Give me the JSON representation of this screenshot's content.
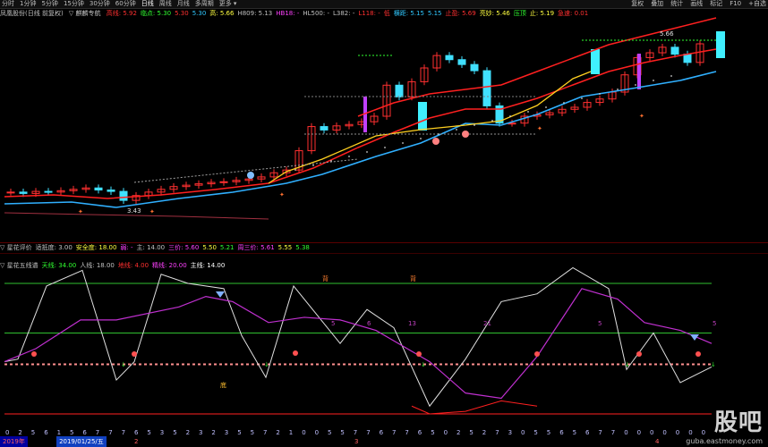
{
  "topbar": {
    "tabs": [
      "分时",
      "1分钟",
      "5分钟",
      "15分钟",
      "30分钟",
      "60分钟",
      "日线",
      "周线",
      "月线",
      "多周期",
      "更多 ▾"
    ],
    "active_tab": "日线",
    "right": [
      "复权",
      "叠加",
      "统计",
      "画线",
      "标记",
      "F10",
      "+自选"
    ]
  },
  "info": {
    "stock": "凤凰股份(日线 前复权)",
    "indicator": "▽ 麒麟专航",
    "items": [
      {
        "t": "高线: 5.92",
        "c": "#ff3030"
      },
      {
        "t": "临点: 5.30",
        "c": "#30ff30"
      },
      {
        "t": "5.30",
        "c": "#ff3030"
      },
      {
        "t": "5.30",
        "c": "#30c8ff"
      },
      {
        "t": "高: 5.66",
        "c": "#ffff40"
      },
      {
        "t": "H809: 5.13",
        "c": "#c0c0c0"
      },
      {
        "t": "HB18: -",
        "c": "#ff40ff"
      },
      {
        "t": "HL500: -",
        "c": "#c0c0c0"
      },
      {
        "t": "L382: -",
        "c": "#c0c0c0"
      },
      {
        "t": "L118: -",
        "c": "#ff3030"
      },
      {
        "t": "低",
        "c": "#ff3030"
      },
      {
        "t": "横距: 5.15",
        "c": "#30c8ff"
      },
      {
        "t": "5.15",
        "c": "#30c8ff"
      },
      {
        "t": "止盈: 5.69",
        "c": "#ff3030"
      },
      {
        "t": "亮妙: 5.46",
        "c": "#ffff40"
      },
      {
        "t": "压顶",
        "c": "#30ff30"
      },
      {
        "t": "止: 5.19",
        "c": "#ffff40"
      },
      {
        "t": "急速: 0.01",
        "c": "#ff3030"
      }
    ]
  },
  "price_labels": {
    "high": "5.66",
    "low": "3.43"
  },
  "panel2": {
    "items": [
      {
        "t": "▽ 星花评价",
        "c": "#c0c0c0"
      },
      {
        "t": "适抵度: 3.00",
        "c": "#c0c0c0"
      },
      {
        "t": "安全度: 18.00",
        "c": "#ffff40"
      },
      {
        "t": "弱: -",
        "c": "#ff40ff"
      },
      {
        "t": "主: 14.00",
        "c": "#c0c0c0"
      },
      {
        "t": "三价: 5.60",
        "c": "#ff40ff"
      },
      {
        "t": "5.50",
        "c": "#ffff40"
      },
      {
        "t": "5.21",
        "c": "#30ff30"
      },
      {
        "t": "周三价: 5.61",
        "c": "#ff40ff"
      },
      {
        "t": "5.55",
        "c": "#ffff40"
      },
      {
        "t": "5.38",
        "c": "#30ff30"
      }
    ]
  },
  "panel3": {
    "items": [
      {
        "t": "▽ 星花五线谱",
        "c": "#c0c0c0"
      },
      {
        "t": "天线: 34.00",
        "c": "#30ff30"
      },
      {
        "t": "人线: 18.00",
        "c": "#c0c0c0"
      },
      {
        "t": "地线: 4.00",
        "c": "#ff3030"
      },
      {
        "t": "精线: 20.00",
        "c": "#ff40ff"
      },
      {
        "t": "主线: 14.00",
        "c": "#ffffff"
      }
    ]
  },
  "signals": {
    "bei": "背",
    "bei2": "背",
    "bottom_mark": "底",
    "nums": [
      "5",
      "6",
      "13",
      "21",
      "5",
      "5"
    ]
  },
  "bottom_numbers": [
    "0",
    "2",
    "5",
    "6",
    "1",
    "5",
    "6",
    "7",
    "7",
    "7",
    "6",
    "5",
    "3",
    "5",
    "2",
    "3",
    "2",
    "3",
    "5",
    "5",
    "7",
    "2",
    "1",
    "0",
    "0",
    "5",
    "5",
    "7",
    "7",
    "6",
    "7",
    "7",
    "6",
    "5",
    "0",
    "2",
    "5",
    "2",
    "7",
    "3",
    "0",
    "5",
    "5",
    "6",
    "5",
    "6",
    "7",
    "7",
    "0",
    "0",
    "0",
    "0",
    "0",
    "0",
    "0"
  ],
  "bottombar": {
    "year": "2019年",
    "date": "2019/01/25/五",
    "month_ticks": [
      "2",
      "3",
      "4"
    ]
  },
  "watermark": {
    "logo": "股吧",
    "url": "guba.eastmoney.com"
  }
}
